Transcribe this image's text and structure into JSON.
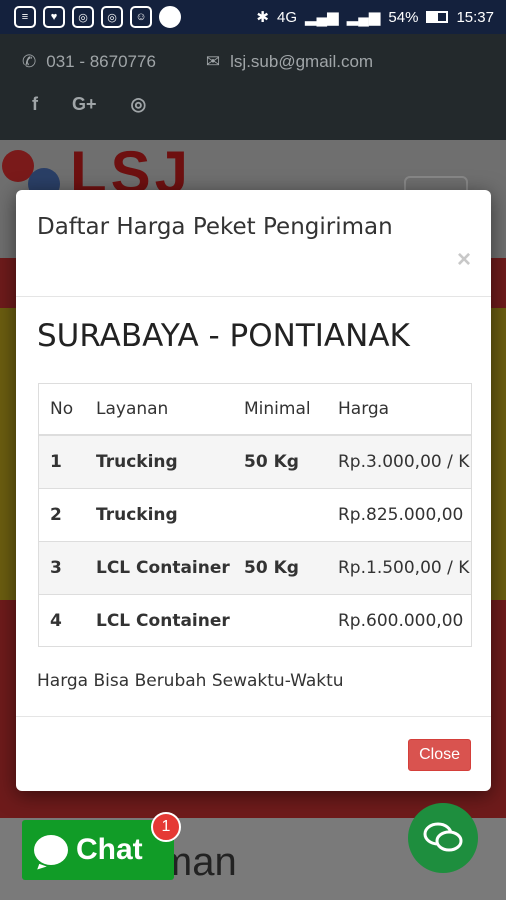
{
  "status_bar": {
    "network": "4G",
    "battery": "54%",
    "time": "15:37"
  },
  "topbar": {
    "phone": "031 - 8670776",
    "email": "lsj.sub@gmail.com"
  },
  "logo": {
    "text": "LSJ"
  },
  "page_heading_partial": "iman",
  "modal": {
    "title": "Daftar Harga Peket Pengiriman",
    "close_icon": "×",
    "route": "SURABAYA - PONTIANAK",
    "table": {
      "headers": [
        "No",
        "Layanan",
        "Minimal",
        "Harga"
      ],
      "rows": [
        {
          "no": "1",
          "layanan": "Trucking",
          "minimal": "50 Kg",
          "harga": "Rp.3.000,00 / K"
        },
        {
          "no": "2",
          "layanan": "Trucking",
          "minimal": "",
          "harga": "Rp.825.000,00"
        },
        {
          "no": "3",
          "layanan": "LCL Container",
          "minimal": "50 Kg",
          "harga": "Rp.1.500,00 / K"
        },
        {
          "no": "4",
          "layanan": "LCL Container",
          "minimal": "",
          "harga": "Rp.600.000,00"
        }
      ]
    },
    "note": "Harga Bisa Berubah Sewaktu-Waktu",
    "close_button": "Close"
  },
  "chat": {
    "label": "Chat",
    "badge_count": "1"
  }
}
